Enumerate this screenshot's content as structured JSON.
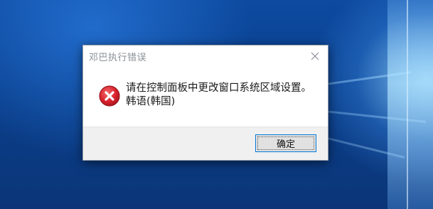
{
  "dialog": {
    "title": "邓巴执行错误",
    "message_line1": "请在控制面板中更改窗口系统区域设置。",
    "message_line2": "韩语(韩国)",
    "ok_label": "确定",
    "icon": "error-icon",
    "close_icon": "close-icon"
  },
  "colors": {
    "error_red": "#d9232e",
    "button_focus": "#0078d7",
    "desktop_blue": "#0b3f86"
  }
}
